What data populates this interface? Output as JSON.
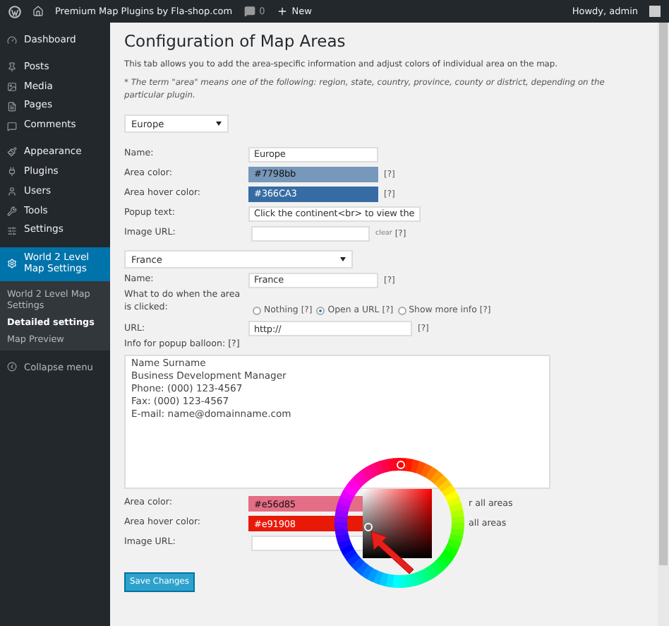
{
  "admin_bar": {
    "site_title": "Premium Map Plugins by Fla-shop.com",
    "comments_count": "0",
    "new_label": "New",
    "greeting": "Howdy, admin"
  },
  "sidebar": {
    "items": [
      {
        "label": "Dashboard",
        "selected": false
      },
      {
        "label": "Posts",
        "selected": false
      },
      {
        "label": "Media",
        "selected": false
      },
      {
        "label": "Pages",
        "selected": false
      },
      {
        "label": "Comments",
        "selected": false
      },
      {
        "label": "Appearance",
        "selected": false
      },
      {
        "label": "Plugins",
        "selected": false
      },
      {
        "label": "Users",
        "selected": false
      },
      {
        "label": "Tools",
        "selected": false
      },
      {
        "label": "Settings",
        "selected": false
      },
      {
        "label": "World 2 Level Map Settings",
        "selected": true
      }
    ],
    "submenu": [
      {
        "label": "World 2 Level Map Settings",
        "selected": false
      },
      {
        "label": "Detailed settings",
        "selected": true
      },
      {
        "label": "Map Preview",
        "selected": false
      }
    ],
    "collapse_label": "Collapse menu"
  },
  "page": {
    "title": "Configuration of Map Areas",
    "description": "This tab allows you to add the area-specific information and adjust colors of individual area on the map.",
    "note": "* The term \"area\" means one of the following: region, state, country, province, county or district, depending on the particular plugin."
  },
  "region": {
    "select": "Europe",
    "fields": [
      {
        "kind": "text",
        "label": "Name:",
        "value": "Europe"
      },
      {
        "kind": "color",
        "label": "Area color:",
        "value": "#7798bb",
        "color": "#7798bb",
        "help": "[?]"
      },
      {
        "kind": "color",
        "label": "Area hover color:",
        "value": "#366CA3",
        "color": "#366ca3",
        "help": "[?]"
      },
      {
        "kind": "text",
        "label": "Popup text:",
        "value": "Click the continent<br> to view the"
      },
      {
        "kind": "image",
        "label": "Image URL:",
        "clear": "clear",
        "help": "[?]"
      }
    ]
  },
  "area": {
    "select": "France",
    "name_label": "Name:",
    "name_value": "France",
    "name_help": "[?]",
    "click_label": "What to do when the area is clicked:",
    "click_options": [
      {
        "label": "Nothing",
        "help": "[?]",
        "selected": false
      },
      {
        "label": "Open a URL",
        "help": "[?]",
        "selected": true
      },
      {
        "label": "Show more info",
        "help": "[?]",
        "selected": false
      }
    ],
    "url_label": "URL:",
    "url_value": "http://",
    "url_help": "[?]",
    "info_label": "Info for popup balloon: [?]",
    "info_text": "Name Surname\nBusiness Development Manager\nPhone: (000) 123-4567\nFax: (000) 123-4567\nE-mail: name@domainname.com",
    "fields": [
      {
        "kind": "color",
        "label": "Area color:",
        "value": "#e56d85",
        "color": "#e56d85",
        "trailing": "r all areas"
      },
      {
        "kind": "color",
        "label": "Area hover color:",
        "value": "#e91908",
        "color": "#e91908",
        "trailing": "all areas"
      },
      {
        "kind": "image",
        "label": "Image URL:"
      }
    ]
  },
  "save_button": "Save Changes"
}
